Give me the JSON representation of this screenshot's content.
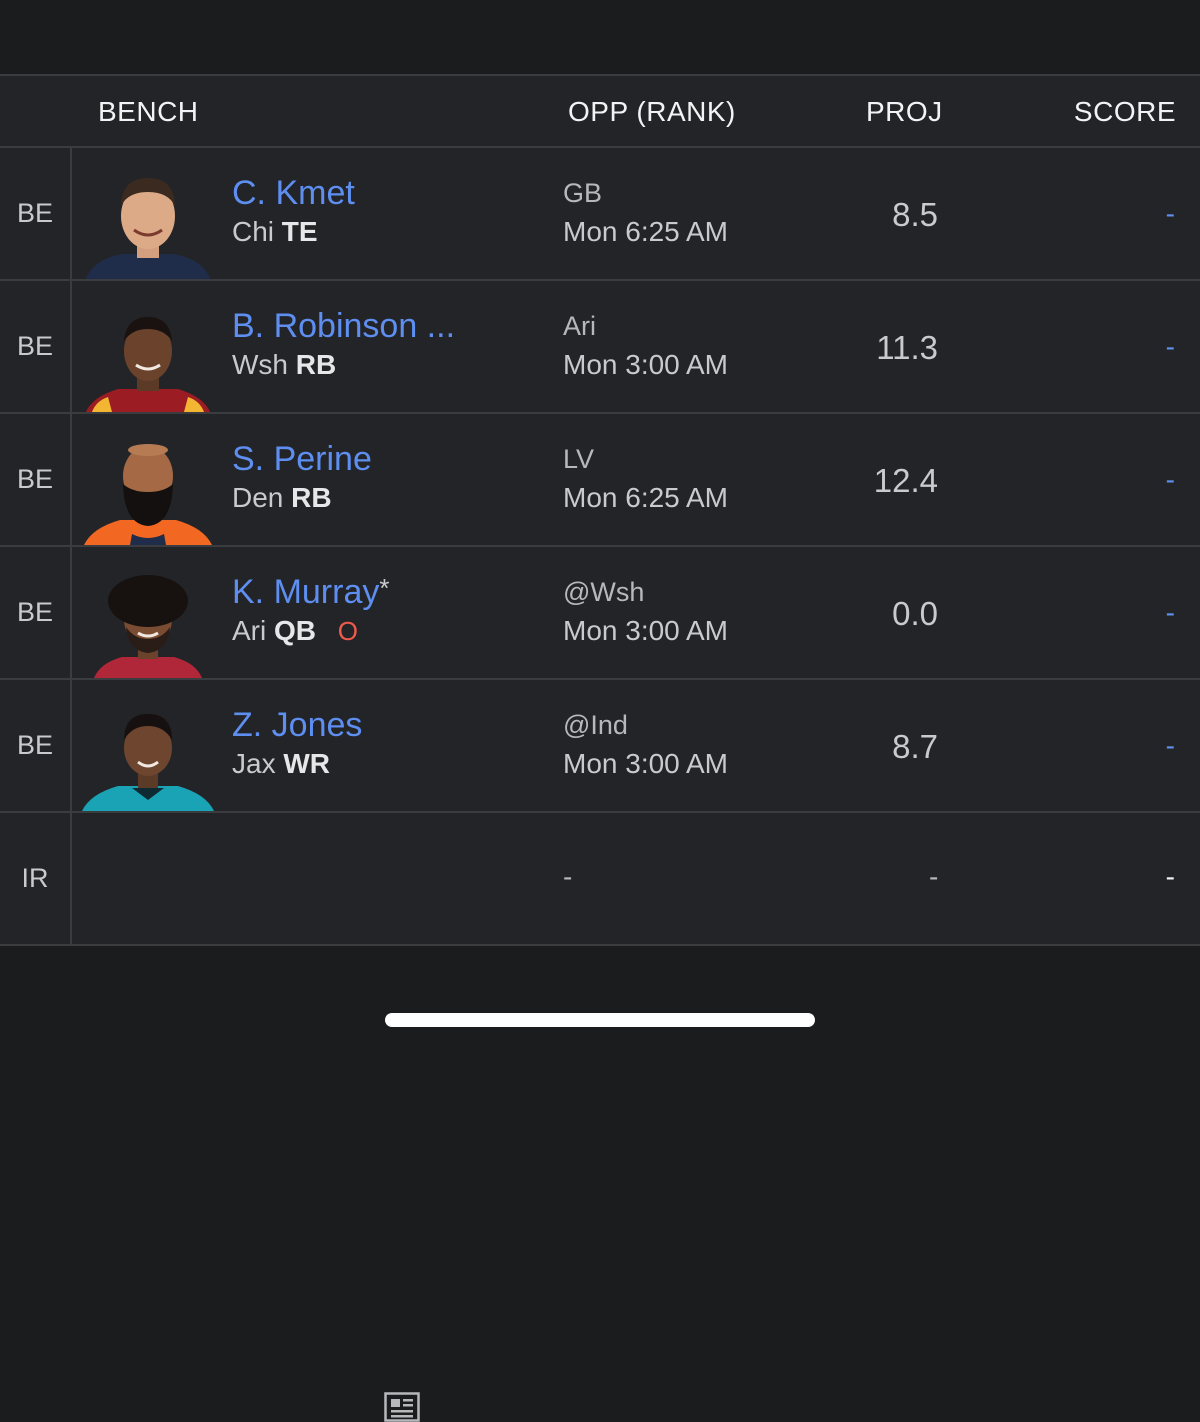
{
  "header": {
    "bench": "BENCH",
    "opp": "OPP (RANK)",
    "proj": "PROJ",
    "score": "SCORE"
  },
  "rows": [
    {
      "slot": "BE",
      "name": "C. Kmet",
      "team": "Chi",
      "pos": "TE",
      "opp": "GB",
      "time": "Mon 6:25 AM",
      "proj": "8.5",
      "score": "-"
    },
    {
      "slot": "BE",
      "name": "B. Robinson ...",
      "team": "Wsh",
      "pos": "RB",
      "opp": "Ari",
      "time": "Mon 3:00 AM",
      "proj": "11.3",
      "score": "-",
      "news": true
    },
    {
      "slot": "BE",
      "name": "S. Perine",
      "team": "Den",
      "pos": "RB",
      "opp": "LV",
      "time": "Mon 6:25 AM",
      "proj": "12.4",
      "score": "-"
    },
    {
      "slot": "BE",
      "name": "K. Murray",
      "star": "*",
      "team": "Ari",
      "pos": "QB",
      "status": "O",
      "opp": "@Wsh",
      "time": "Mon 3:00 AM",
      "proj": "0.0",
      "score": "-"
    },
    {
      "slot": "BE",
      "name": "Z. Jones",
      "team": "Jax",
      "pos": "WR",
      "opp": "@Ind",
      "time": "Mon 3:00 AM",
      "proj": "8.7",
      "score": "-",
      "news": true
    },
    {
      "slot": "IR",
      "opp": "-",
      "proj": "-",
      "score": "-"
    }
  ],
  "colors": {
    "background": "#1b1c1e",
    "row": "#232427",
    "link": "#5d8ef0",
    "status_out": "#ef5a4d"
  },
  "icons": {
    "news": "newspaper-icon"
  }
}
